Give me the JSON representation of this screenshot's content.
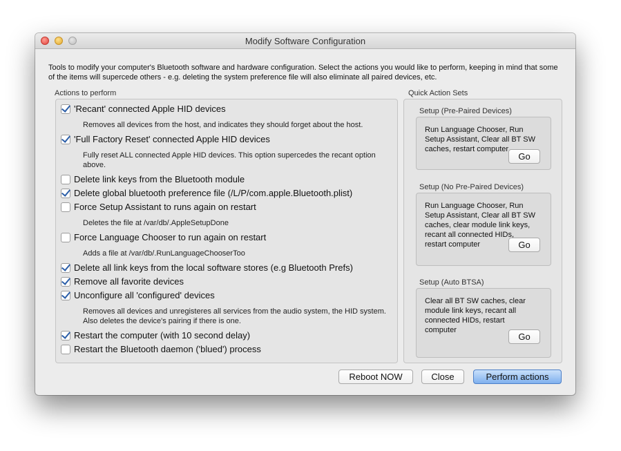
{
  "window": {
    "title": "Modify Software Configuration"
  },
  "intro": "Tools to modify your computer's Bluetooth software and hardware configuration. Select the actions you would like to perform, keeping in mind that some of the items will supercede others - e.g. deleting the system preference file will also eliminate all paired devices, etc.",
  "actions": {
    "label": "Actions to perform",
    "items": [
      {
        "label": "'Recant' connected Apple HID devices",
        "checked": true,
        "note": "Removes all devices from the host, and indicates they should forget about the host."
      },
      {
        "label": "'Full Factory Reset' connected Apple HID devices",
        "checked": true,
        "note": "Fully reset ALL connected Apple HID devices. This option supercedes the recant option above."
      },
      {
        "label": "Delete link keys from the Bluetooth module",
        "checked": false
      },
      {
        "label": "Delete global bluetooth preference file (/L/P/com.apple.Bluetooth.plist)",
        "checked": true
      },
      {
        "label": "Force Setup Assistant to runs again on restart",
        "checked": false,
        "note": "Deletes the file at /var/db/.AppleSetupDone"
      },
      {
        "label": "Force Language Chooser to run again on restart",
        "checked": false,
        "note": "Adds a file at /var/db/.RunLanguageChooserToo"
      },
      {
        "label": "Delete all link keys from the local software stores (e.g Bluetooth Prefs)",
        "checked": true
      },
      {
        "label": "Remove all favorite devices",
        "checked": true
      },
      {
        "label": "Unconfigure all 'configured' devices",
        "checked": true,
        "note": "Removes all devices and unregisteres all services from the audio system, the HID system. Also deletes the device's pairing if there is one."
      },
      {
        "label": "Restart the computer (with 10 second delay)",
        "checked": true
      },
      {
        "label": "Restart the Bluetooth daemon ('blued') process",
        "checked": false
      }
    ]
  },
  "quick": {
    "label": "Quick Action Sets",
    "sets": [
      {
        "label": "Setup (Pre-Paired Devices)",
        "text": "Run Language Chooser, Run Setup Assistant, Clear all BT SW caches, restart computer",
        "go": "Go"
      },
      {
        "label": "Setup (No Pre-Paired Devices)",
        "text": "Run Language Chooser, Run Setup Assistant, Clear all BT SW caches, clear module link keys, recant all connected HIDs, restart computer",
        "go": "Go"
      },
      {
        "label": "Setup (Auto BTSA)",
        "text": "Clear all BT SW caches, clear module link keys, recant all connected HIDs, restart computer",
        "go": "Go"
      }
    ]
  },
  "buttons": {
    "reboot": "Reboot NOW",
    "close": "Close",
    "perform": "Perform actions"
  }
}
